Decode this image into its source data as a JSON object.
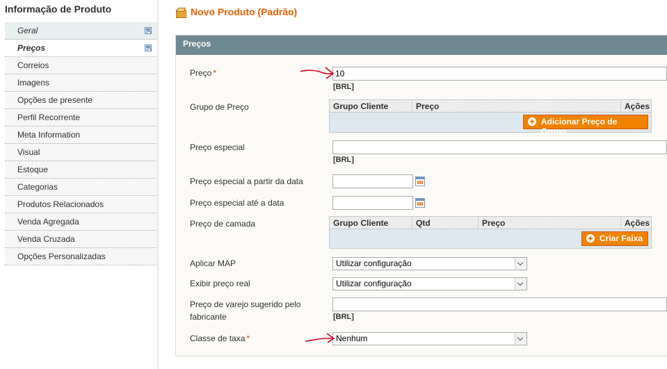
{
  "sidebar": {
    "title": "Informação de Produto",
    "items": [
      {
        "label": "Geral"
      },
      {
        "label": "Preços"
      },
      {
        "label": "Correios"
      },
      {
        "label": "Imagens"
      },
      {
        "label": "Opções de presente"
      },
      {
        "label": "Perfil Recorrente"
      },
      {
        "label": "Meta Information"
      },
      {
        "label": "Visual"
      },
      {
        "label": "Estoque"
      },
      {
        "label": "Categorias"
      },
      {
        "label": "Produtos Relacionados"
      },
      {
        "label": "Venda Agregada"
      },
      {
        "label": "Venda Cruzada"
      },
      {
        "label": "Opções Personalizadas"
      }
    ]
  },
  "header": {
    "title": "Novo Produto (Padrão)"
  },
  "section": {
    "title": "Preços"
  },
  "form": {
    "price": {
      "label": "Preço",
      "required_mark": "*",
      "value": "10",
      "currency_note": "[BRL]"
    },
    "group_price": {
      "label": "Grupo de Preço",
      "columns": [
        "Grupo Cliente",
        "Preço",
        "Ações"
      ],
      "add_button": "Adicionar Preço de Grupo"
    },
    "special_price": {
      "label": "Preço especial",
      "value": "",
      "currency_note": "[BRL]"
    },
    "special_from": {
      "label": "Preço especial a partir da data",
      "value": ""
    },
    "special_to": {
      "label": "Preço especial até a data",
      "value": ""
    },
    "tier_price": {
      "label": "Preço de camada",
      "columns": [
        "Grupo Cliente",
        "Qtd",
        "Preço",
        "Ações"
      ],
      "add_button": "Criar Faixa"
    },
    "apply_map": {
      "label": "Aplicar MAP",
      "selected": "Utilizar configuração"
    },
    "show_actual_price": {
      "label": "Exibir preço real",
      "selected": "Utilizar configuração"
    },
    "msrp": {
      "label_line1": "Preço de varejo sugerido pelo",
      "label_line2": "fabricante",
      "value": "",
      "currency_note": "[BRL]"
    },
    "tax_class": {
      "label": "Classe de taxa",
      "required_mark": "*",
      "selected": "Nenhum"
    }
  },
  "colors": {
    "accent": "#eb5e00",
    "button": "#f18200",
    "section_header": "#6f8992",
    "annotation": "#d0021b"
  }
}
